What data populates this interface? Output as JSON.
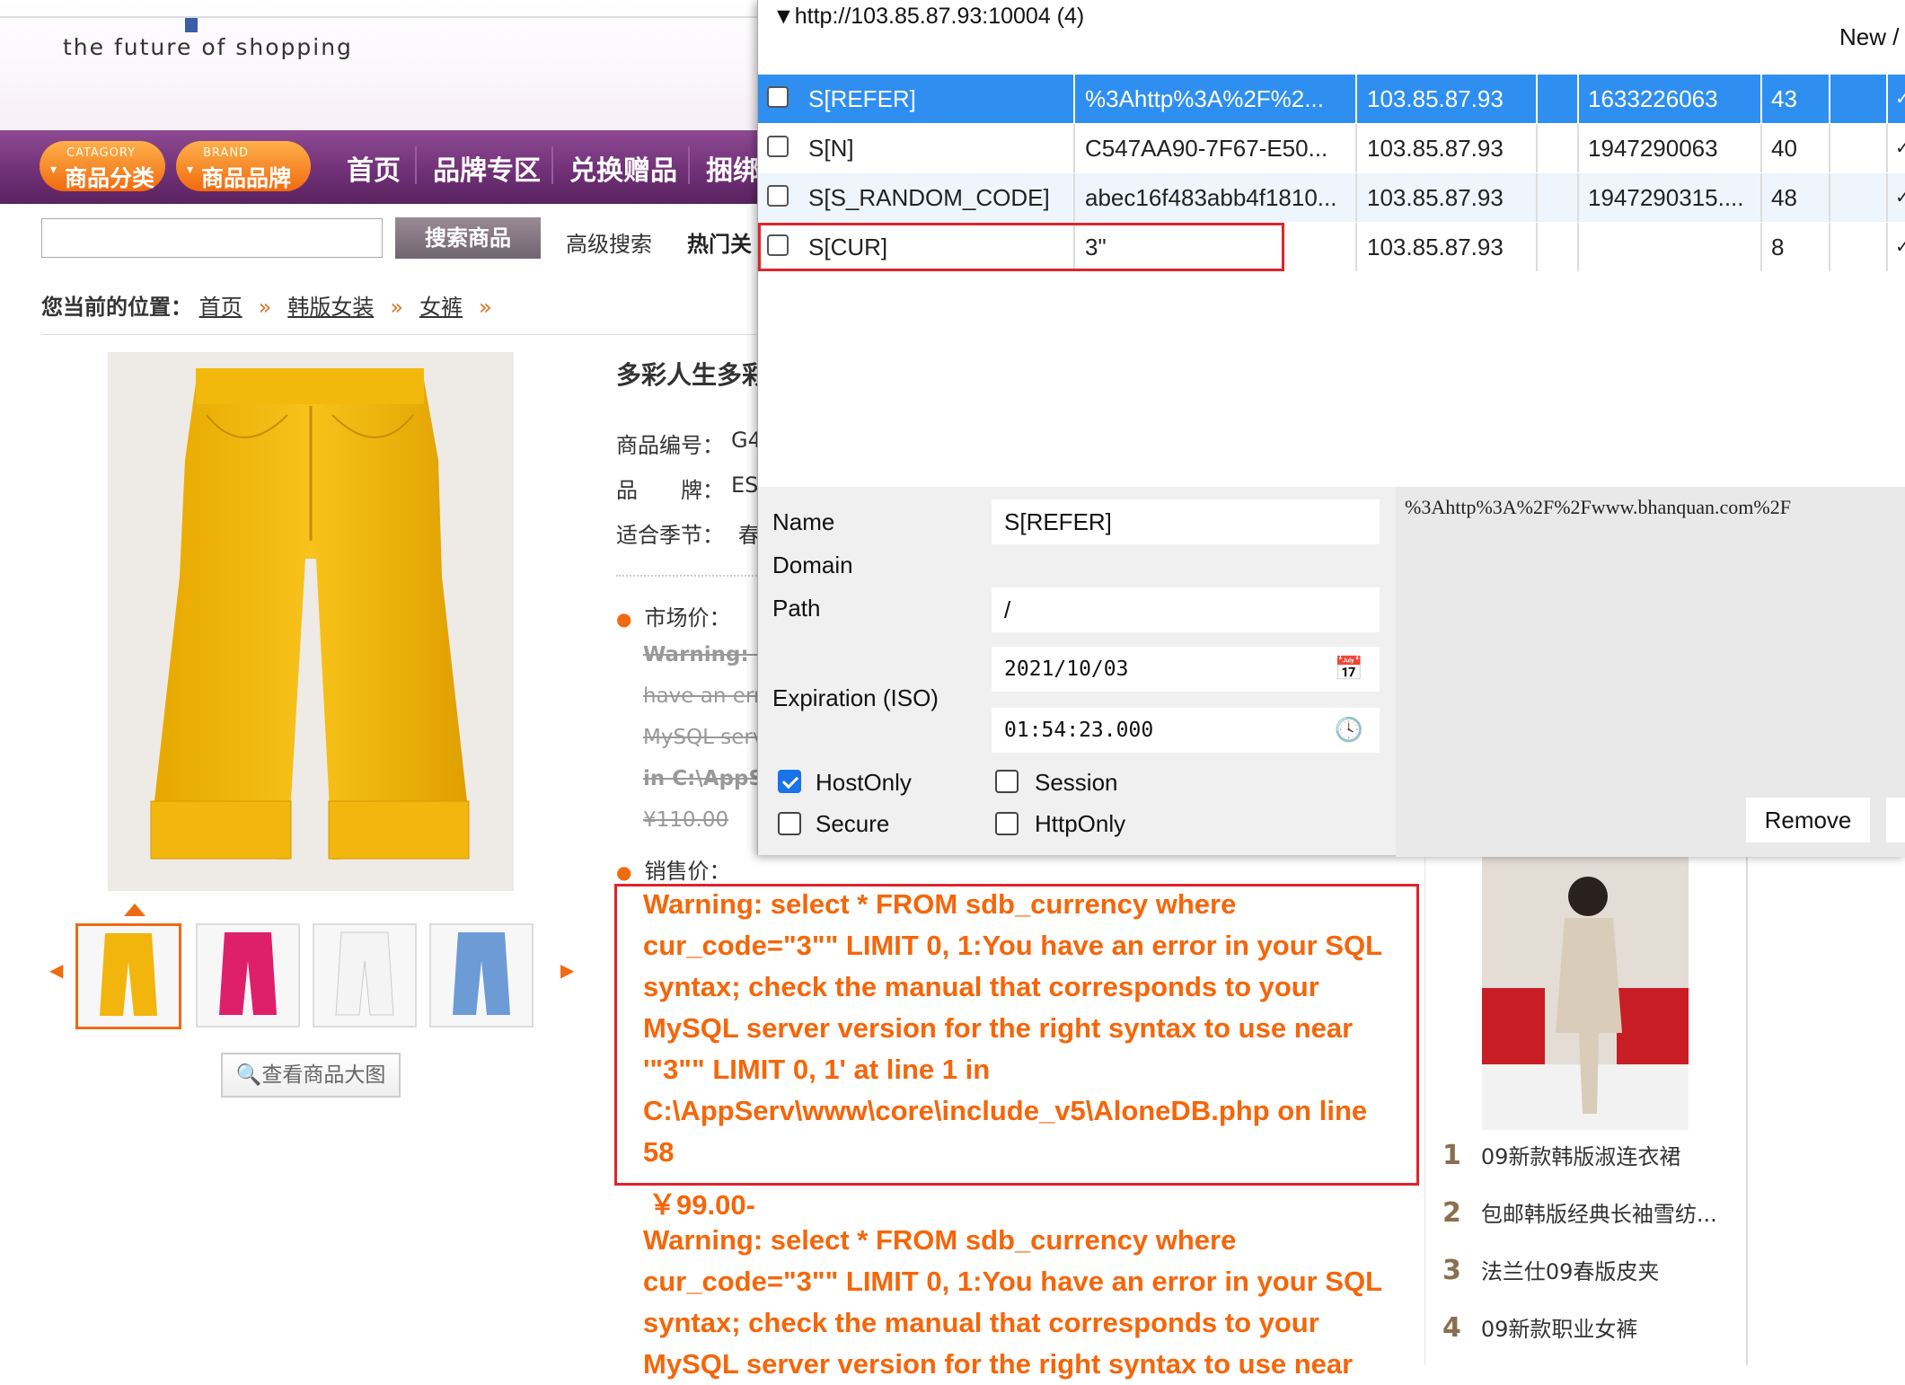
{
  "shop": {
    "tagline": "the future of shopping",
    "nav": {
      "category_caption": "CATAGORY",
      "category_label": "商品分类",
      "brand_caption": "BRAND",
      "brand_label": "商品品牌",
      "links": [
        "首页",
        "品牌专区",
        "兑换赠品",
        "捆绑"
      ]
    },
    "search": {
      "input_value": "",
      "button_label": "搜索商品",
      "advanced_label": "高级搜索",
      "hot_label": "热门关"
    },
    "breadcrumb": {
      "label": "您当前的位置：",
      "items": [
        "首页",
        "韩版女装",
        "女裤"
      ],
      "sep": "»"
    },
    "product": {
      "title": "多彩人生多彩",
      "attrs": [
        {
          "label": "商品编号：",
          "value": "G4"
        },
        {
          "label": "品　　牌：",
          "value": "ES"
        },
        {
          "label": "适合季节：",
          "value": "春"
        }
      ],
      "market_price_label": "市场价：",
      "market_price_lines": [
        "Warning: s",
        "have an erro",
        "MySQL serv",
        "in C:\\AppS",
        "¥110.00"
      ],
      "sale_price_label": "销售价：",
      "view_large_label": "查看商品大图"
    },
    "warning_boxed": [
      "Warning: select * FROM sdb_currency where",
      "cur_code=\"3\"\" LIMIT 0, 1:You have an error in your SQL",
      "syntax; check the manual that corresponds to your",
      "MySQL server version for the right syntax to use near",
      "'\"3\"\" LIMIT 0, 1' at line 1 in",
      "C:\\AppServ\\www\\core\\include_v5\\AloneDB.php on line",
      "58"
    ],
    "sale_price": "￥99.00-",
    "warning_repeat": [
      "Warning: select * FROM sdb_currency where",
      "cur_code=\"3\"\" LIMIT 0, 1:You have an error in your SQL",
      "syntax; check the manual that corresponds to your",
      "MySQL server version for the right syntax to use near"
    ],
    "ranking": [
      {
        "num": "1",
        "label": "09新款韩版淑连衣裙"
      },
      {
        "num": "2",
        "label": "包邮韩版经典长袖雪纺..."
      },
      {
        "num": "3",
        "label": "法兰仕09春版皮夹"
      },
      {
        "num": "4",
        "label": "09新款职业女裤"
      }
    ]
  },
  "cookie_editor": {
    "host": "▼http://103.85.87.93:10004 (4)",
    "new_label": "New /",
    "rows": [
      {
        "name": "S[REFER]",
        "value": "%3Ahttp%3A%2F%2...",
        "domain": "103.85.87.93",
        "expires": "1633226063",
        "size": "43",
        "tick": "✓"
      },
      {
        "name": "S[N]",
        "value": "C547AA90-7F67-E50...",
        "domain": "103.85.87.93",
        "expires": "1947290063",
        "size": "40",
        "tick": "✓"
      },
      {
        "name": "S[S_RANDOM_CODE]",
        "value": "abec16f483abb4f1810...",
        "domain": "103.85.87.93",
        "expires": "1947290315....",
        "size": "48",
        "tick": "✓"
      },
      {
        "name": "S[CUR]",
        "value": "3\"",
        "domain": "103.85.87.93",
        "expires": "",
        "size": "8",
        "tick": "✓"
      }
    ],
    "detail": {
      "name_label": "Name",
      "name_value": "S[REFER]",
      "domain_label": "Domain",
      "path_label": "Path",
      "path_value": "/",
      "expiration_label": "Expiration (ISO)",
      "date_value": "2021/10/03",
      "time_value": "01:54:23.000",
      "hostonly_label": "HostOnly",
      "session_label": "Session",
      "secure_label": "Secure",
      "httponly_label": "HttpOnly",
      "value_text": "%3Ahttp%3A%2F%2Fwww.bhanquan.com%2F",
      "remove_label": "Remove"
    },
    "accent": "#2f8ff0",
    "highlight": "#e0242c"
  }
}
